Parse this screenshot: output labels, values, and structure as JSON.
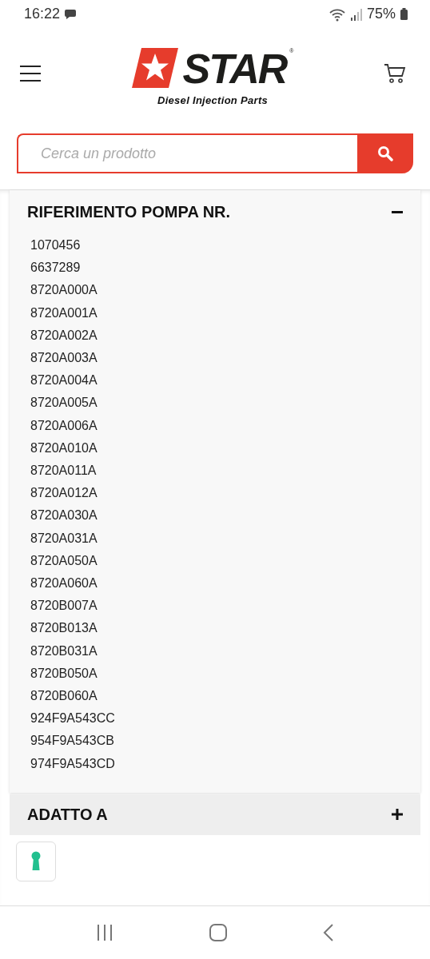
{
  "status_bar": {
    "time": "16:22",
    "battery": "75%"
  },
  "header": {
    "logo_word": "STAR",
    "logo_mark": "®",
    "tagline": "Diesel Injection Parts"
  },
  "search": {
    "placeholder": "Cerca un prodotto"
  },
  "sections": [
    {
      "title": "RIFERIMENTO POMPA NR.",
      "expanded": true,
      "items": [
        "1070456",
        "6637289",
        "8720A000A",
        "8720A001A",
        "8720A002A",
        "8720A003A",
        "8720A004A",
        "8720A005A",
        "8720A006A",
        "8720A010A",
        "8720A011A",
        "8720A012A",
        "8720A030A",
        "8720A031A",
        "8720A050A",
        "8720A060A",
        "8720B007A",
        "8720B013A",
        "8720B031A",
        "8720B050A",
        "8720B060A",
        "924F9A543CC",
        "954F9A543CB",
        "974F9A543CD"
      ]
    },
    {
      "title": "ADATTO A",
      "expanded": false
    }
  ]
}
